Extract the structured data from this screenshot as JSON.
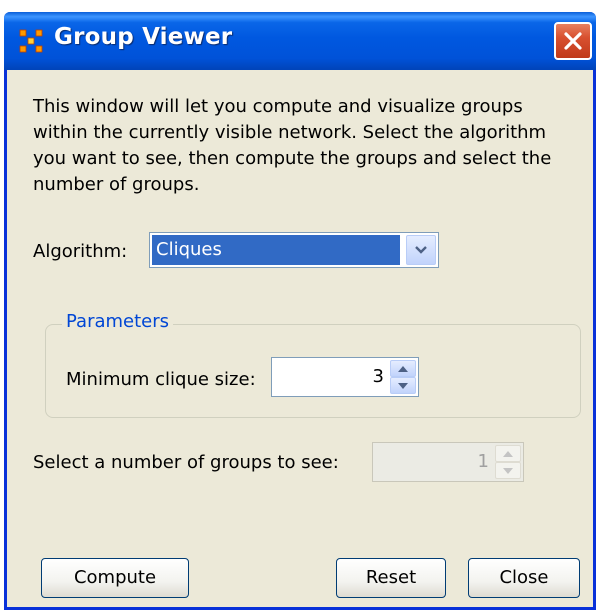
{
  "window": {
    "title": "Group Viewer",
    "icons": {
      "app": "network-grid-icon",
      "close": "close-x-icon"
    }
  },
  "description": "This window will let you compute and visualize groups within the currently visible network. Select the algorithm you want to see, then compute the groups and select the number of groups.",
  "algorithm": {
    "label": "Algorithm:",
    "selected": "Cliques"
  },
  "parameters": {
    "legend": "Parameters",
    "min_clique_label": "Minimum clique size:",
    "min_clique_value": "3"
  },
  "groups": {
    "label": "Select a number of groups to see:",
    "value": "1",
    "enabled": false
  },
  "buttons": {
    "compute": "Compute",
    "reset": "Reset",
    "close": "Close"
  },
  "colors": {
    "titlebar": "#0058e0",
    "selection": "#316ac5",
    "legend_text": "#0046d5",
    "background": "#ece9d8"
  }
}
